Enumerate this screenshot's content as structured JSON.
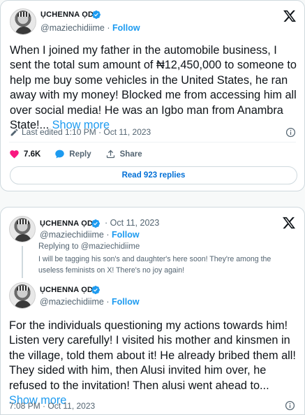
{
  "tweet1": {
    "author_name": "ỤCHENNA ỌDU",
    "handle": "@maziechidiime",
    "separator": "·",
    "follow_label": "Follow",
    "text": "When I joined my father in the automobile business, I sent the total sum amount of ₦12,450,000 to someone to help me buy some vehicles in the United States, he ran away with my money! Blocked me from accessing him all over social media! He was an Igbo man from Anambra State!...",
    "show_more": "Show more",
    "edited_label": "Last edited 1:10 PM · Oct 11, 2023",
    "likes": "7.6K",
    "reply_label": "Reply",
    "share_label": "Share",
    "read_replies": "Read 923 replies"
  },
  "tweet2": {
    "parent": {
      "author_name": "ỤCHENNA ỌDU",
      "handle": "@maziechidiime",
      "separator": "·",
      "date": "Oct 11, 2023",
      "follow_label": "Follow",
      "replying_to": "Replying to @maziechidiime",
      "text": "I will be tagging his son's and daughter's here soon! They're among the useless feminists on X! There's no joy again!"
    },
    "reply": {
      "author_name": "ỤCHENNA ỌDU",
      "handle": "@maziechidiime",
      "separator": "·",
      "follow_label": "Follow",
      "text": "For the individuals questioning my actions towards him! Listen very carefully! I visited his mother and kinsmen in the village, told them about it! He already bribed them all! They sided with him, then Alusi invited him over, he refused to the invitation! Then alusi went ahead to...",
      "show_more": "Show more",
      "timestamp": "7:08 PM · Oct 11, 2023"
    }
  },
  "icons": {
    "verified": "verified-badge-icon",
    "x_logo": "x-logo-icon",
    "info": "info-icon",
    "pencil": "pencil-icon",
    "heart": "heart-icon",
    "reply": "speech-bubble-icon",
    "share": "share-upload-icon"
  },
  "colors": {
    "accent": "#1d9bf0",
    "like": "#f91880",
    "text": "#0f1419",
    "muted": "#536471"
  }
}
